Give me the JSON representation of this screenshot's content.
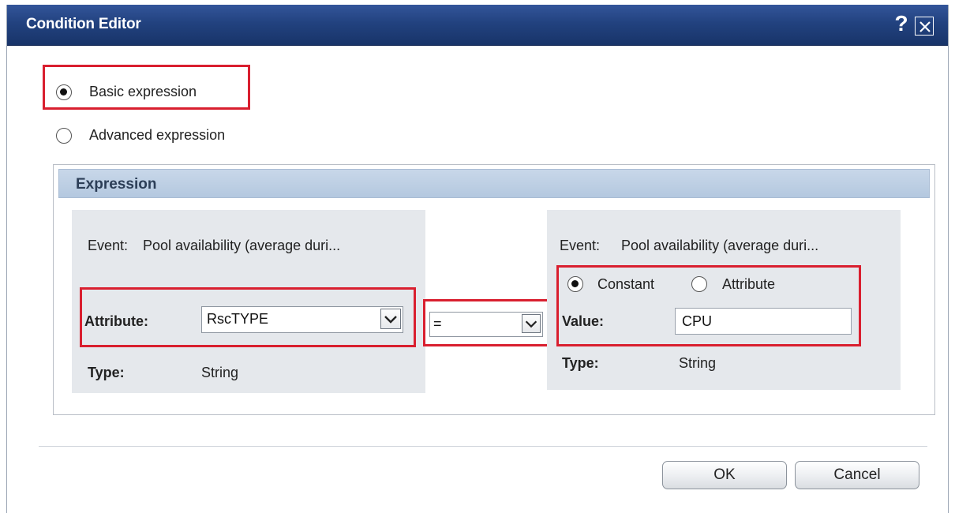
{
  "dialog": {
    "title": "Condition Editor",
    "help_glyph": "?",
    "close_icon": "close-icon"
  },
  "mode": {
    "basic_label": "Basic expression",
    "advanced_label": "Advanced expression",
    "selected": "basic"
  },
  "expression": {
    "header": "Expression",
    "left": {
      "event_label": "Event:",
      "event_value": "Pool availability (average duri...",
      "attribute_label": "Attribute:",
      "attribute_value": "RscTYPE",
      "type_label": "Type:",
      "type_value": "String"
    },
    "operator": {
      "value": "="
    },
    "right": {
      "event_label": "Event:",
      "event_value": "Pool availability (average duri...",
      "constant_label": "Constant",
      "attribute_label": "Attribute",
      "selected": "constant",
      "value_label": "Value:",
      "value": "CPU",
      "type_label": "Type:",
      "type_value": "String"
    }
  },
  "buttons": {
    "ok": "OK",
    "cancel": "Cancel"
  },
  "colors": {
    "titlebar": "#22427f",
    "highlight": "#d91f2f",
    "group_header": "#b4c8df",
    "panel": "#e5e8ec"
  }
}
